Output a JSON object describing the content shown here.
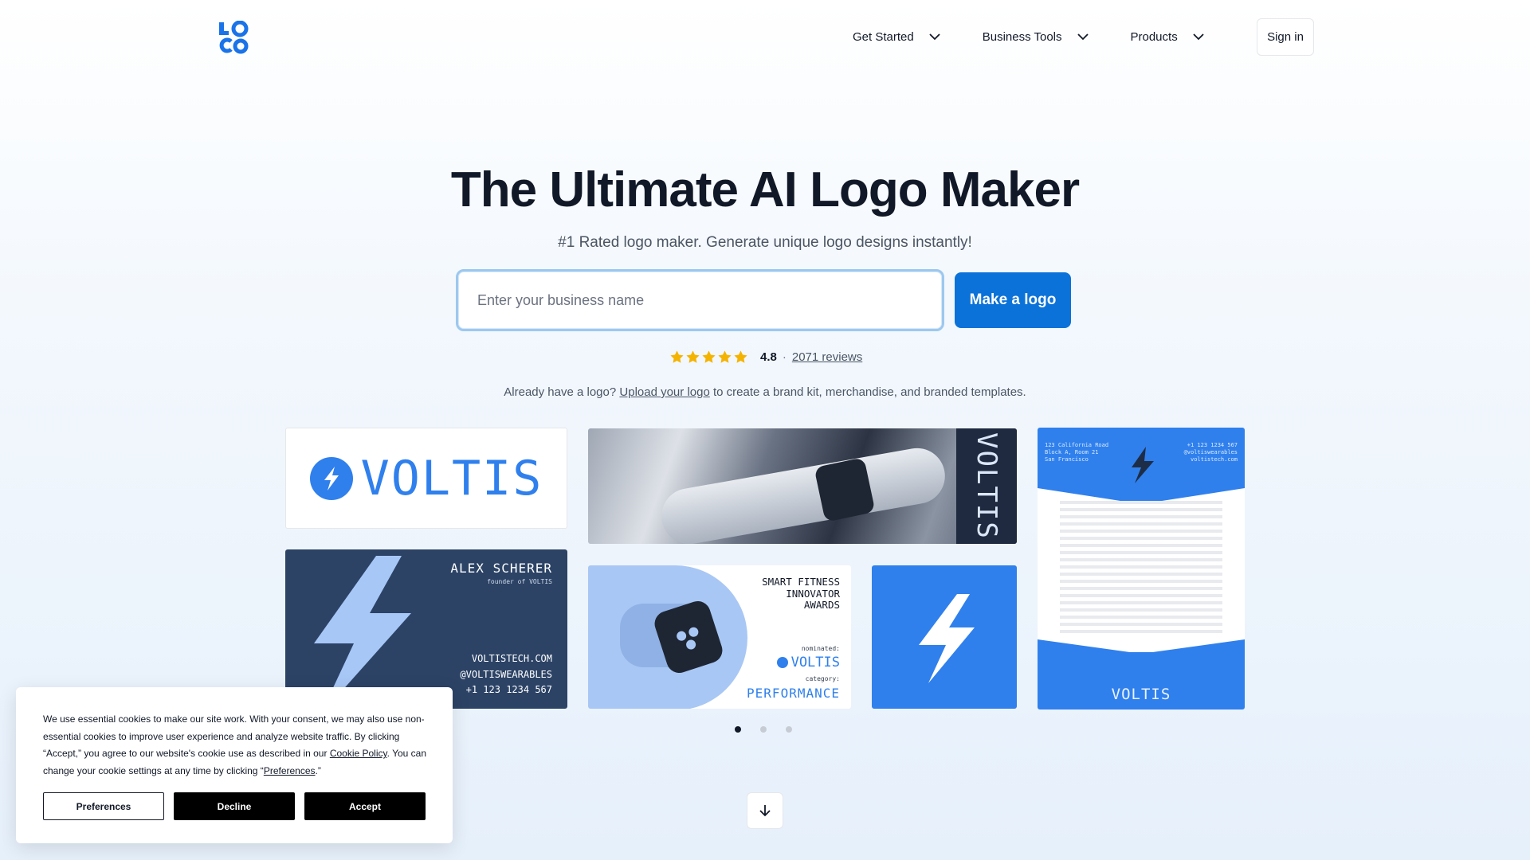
{
  "header": {
    "nav": [
      {
        "label": "Get Started"
      },
      {
        "label": "Business Tools"
      },
      {
        "label": "Products"
      }
    ],
    "signin_label": "Sign in",
    "logo_icon": "logo-mark"
  },
  "hero": {
    "title": "The Ultimate AI Logo Maker",
    "subtitle": "#1 Rated logo maker. Generate unique logo designs instantly!",
    "input_placeholder": "Enter your business name",
    "input_value": "",
    "cta_label": "Make a logo",
    "rating": {
      "stars": 5,
      "score": "4.8",
      "separator": "·",
      "reviews": "2071 reviews",
      "star_color": "#f5b301"
    },
    "already_prefix": "Already have a logo?",
    "already_link": "Upload your logo",
    "already_suffix": "to create a brand kit, merchandise, and branded templates."
  },
  "gallery": {
    "logo_card_word": "VOLTIS",
    "photo_side_word": "VOLTIS",
    "letterhead": {
      "address": [
        "123 California Road",
        "Block A, Room 21",
        "San Francisco"
      ],
      "contact": [
        "+1 123 1234 567",
        "@voltiswearables",
        "voltistech.com"
      ],
      "footer": "VOLTIS"
    },
    "business_card": {
      "name": "ALEX SCHERER",
      "role": "founder of VOLTIS",
      "info": [
        "VOLTISTECH.COM",
        "@VOLTISWEARABLES",
        "+1 123 1234 567"
      ]
    },
    "award": {
      "heading": [
        "SMART FITNESS",
        "INNOVATOR",
        "AWARDS"
      ],
      "nominated_label": "nominated:",
      "brand": "VOLTIS",
      "category_label": "category:",
      "category": "PERFORMANCE"
    },
    "accent_color": "#2f80ed",
    "carousel": {
      "pages": 3,
      "active": 1
    }
  },
  "scroll_icon": "arrow-down-icon",
  "cookie": {
    "text_1": "We use essential cookies to make our site work. With your consent, we may also use non-essential cookies to improve user experience and analyze website traffic. By clicking “Accept,” you agree to our website's cookie use as described in our ",
    "policy_link": "Cookie Policy",
    "text_2": ". You can change your cookie settings at any time by clicking “",
    "pref_link": "Preferences",
    "text_3": ".”",
    "preferences_label": "Preferences",
    "decline_label": "Decline",
    "accept_label": "Accept"
  }
}
